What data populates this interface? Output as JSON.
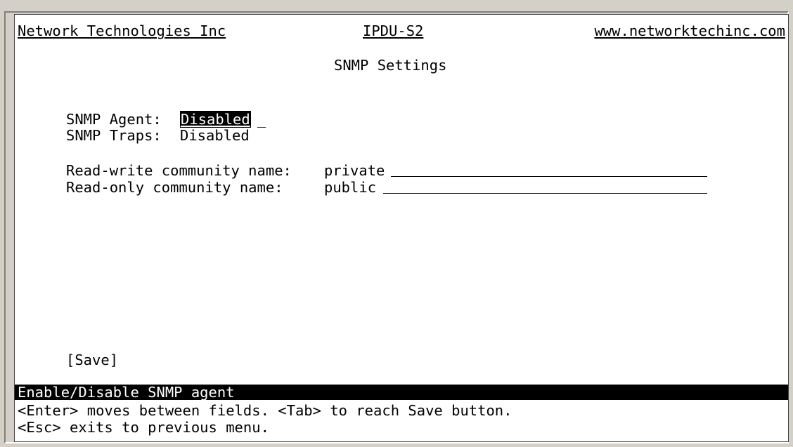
{
  "header": {
    "left": "Network Technologies Inc",
    "center": "IPDU-S2",
    "right": "www.networktechinc.com"
  },
  "title": "SNMP Settings",
  "fields": {
    "snmp_agent_label": "SNMP Agent:",
    "snmp_agent_value": "Disabled",
    "snmp_agent_cursor": "_",
    "snmp_traps_label": "SNMP Traps:",
    "snmp_traps_value": "Disabled",
    "rw_label": "Read-write community name:",
    "rw_value": "private",
    "ro_label": "Read-only community name:",
    "ro_value": "public"
  },
  "save_label": "[Save]",
  "status": "Enable/Disable SNMP agent",
  "help": [
    "<Enter> moves between fields. <Tab> to reach Save button.",
    "<Esc> exits to previous menu."
  ],
  "colors": {
    "background": "#ffffff",
    "foreground": "#000000",
    "highlight_bg": "#000000",
    "highlight_fg": "#ffffff",
    "window_chrome": "#d4d0c8"
  }
}
